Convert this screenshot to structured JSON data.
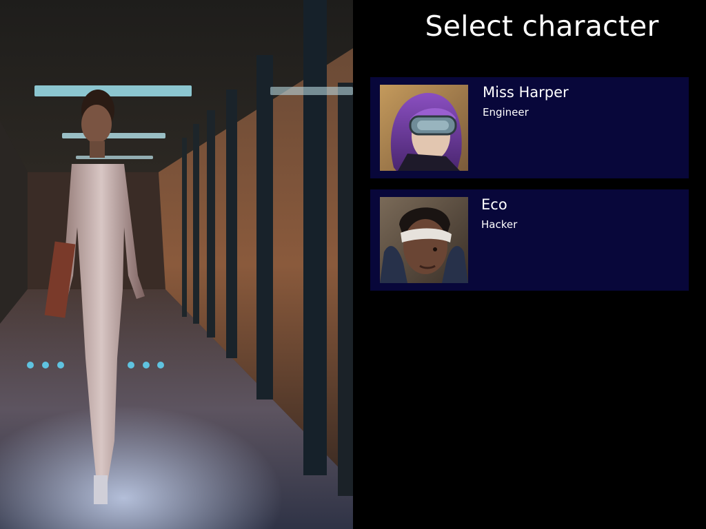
{
  "screen": {
    "title": "Select character"
  },
  "characters": [
    {
      "name": "Miss Harper",
      "role": "Engineer",
      "portrait": "purple-haired-woman-with-goggles"
    },
    {
      "name": "Eco",
      "role": "Hacker",
      "portrait": "man-with-bandaged-eye"
    }
  ],
  "colors": {
    "background": "#000000",
    "card_background": "#08073a",
    "text": "#ffffff"
  }
}
